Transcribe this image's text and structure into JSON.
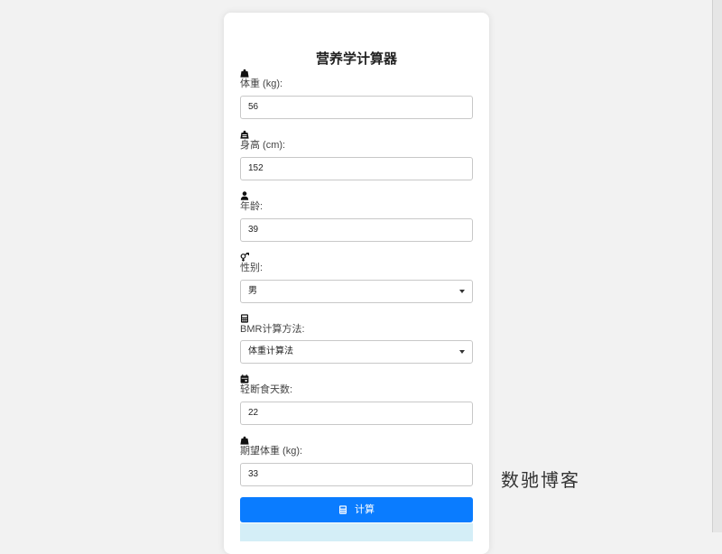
{
  "page": {
    "title": "营养学计算器",
    "watermark": "数驰博客"
  },
  "form": {
    "weight": {
      "label": "体重 (kg):",
      "value": "56",
      "icon": "weight-icon"
    },
    "height": {
      "label": "身高 (cm):",
      "value": "152",
      "icon": "ruler-icon"
    },
    "age": {
      "label": "年龄:",
      "value": "39",
      "icon": "user-icon"
    },
    "gender": {
      "label": "性别:",
      "value": "男",
      "icon": "venus-mars-icon"
    },
    "bmr_method": {
      "label": "BMR计算方法:",
      "value": "体重计算法",
      "icon": "calculator-icon"
    },
    "fasting_days": {
      "label": "轻断食天数:",
      "value": "22",
      "icon": "calendar-icon"
    },
    "target_weight": {
      "label": "期望体重 (kg):",
      "value": "33",
      "icon": "weight-icon"
    }
  },
  "actions": {
    "calculate_label": "计算"
  },
  "colors": {
    "primary": "#0a7cff",
    "result_bg": "#d4eef7",
    "page_bg": "#f2f2f2"
  }
}
